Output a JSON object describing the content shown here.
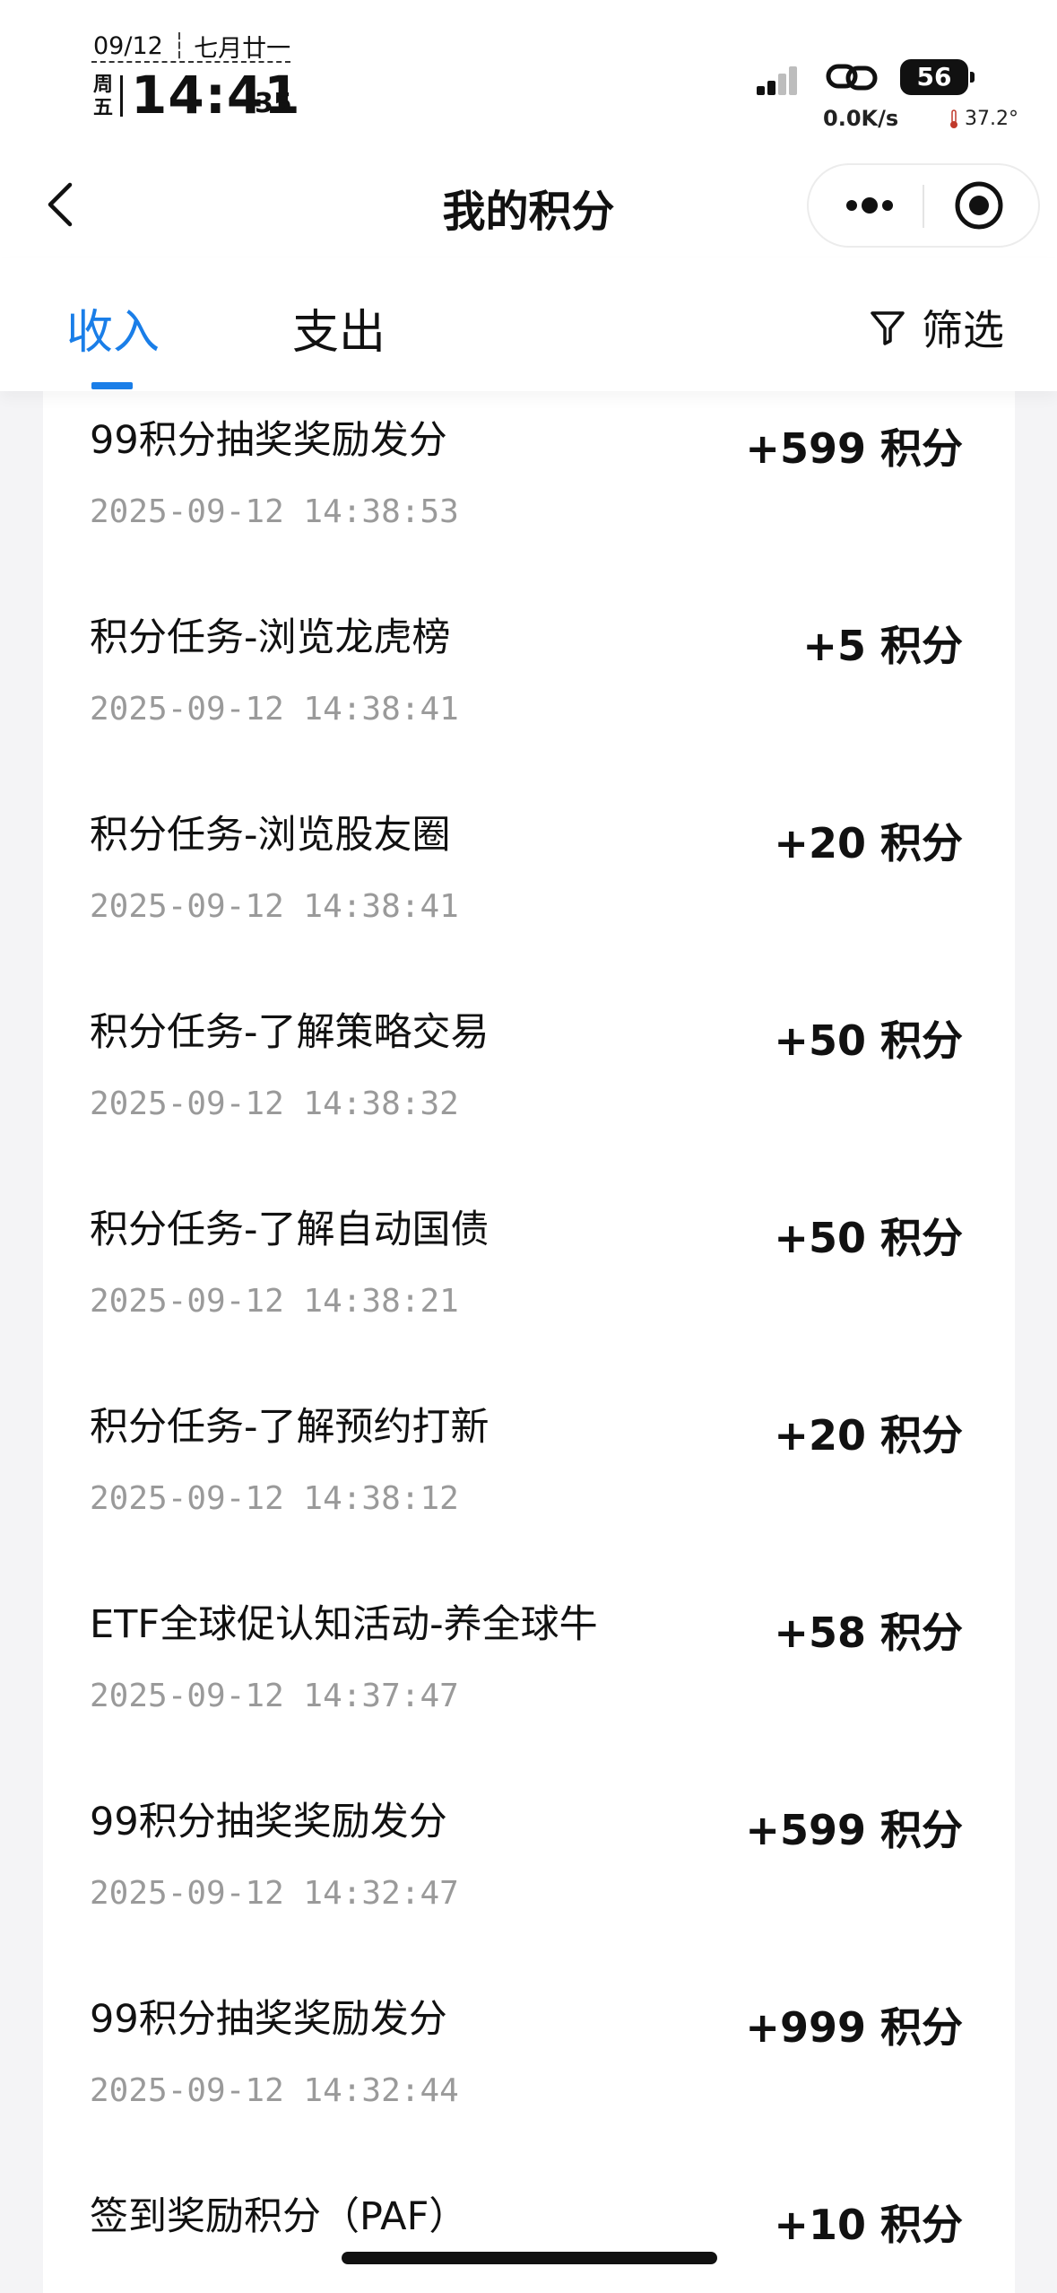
{
  "status_bar": {
    "date": "09/12",
    "lunar": "七月廿一",
    "weekday": "周五",
    "time": "14:41",
    "seconds": "35",
    "net_speed": "0.0K/s",
    "battery": "56",
    "temperature": "37.2°"
  },
  "nav": {
    "title": "我的积分"
  },
  "tabs": {
    "income": "收入",
    "expense": "支出",
    "filter": "筛选",
    "active": "income"
  },
  "colors": {
    "accent": "#1a7ee8",
    "background": "#f4f4f6",
    "time_text": "#9a9a9a"
  },
  "records": [
    {
      "title": "99积分抽奖奖励发分",
      "time": "2025-09-12 14:38:53",
      "points": "+599 积分"
    },
    {
      "title": "积分任务-浏览龙虎榜",
      "time": "2025-09-12 14:38:41",
      "points": "+5 积分"
    },
    {
      "title": "积分任务-浏览股友圈",
      "time": "2025-09-12 14:38:41",
      "points": "+20 积分"
    },
    {
      "title": "积分任务-了解策略交易",
      "time": "2025-09-12 14:38:32",
      "points": "+50 积分"
    },
    {
      "title": "积分任务-了解自动国债",
      "time": "2025-09-12 14:38:21",
      "points": "+50 积分"
    },
    {
      "title": "积分任务-了解预约打新",
      "time": "2025-09-12 14:38:12",
      "points": "+20 积分"
    },
    {
      "title": "ETF全球促认知活动-养全球牛",
      "time": "2025-09-12 14:37:47",
      "points": "+58 积分"
    },
    {
      "title": "99积分抽奖奖励发分",
      "time": "2025-09-12 14:32:47",
      "points": "+599 积分"
    },
    {
      "title": "99积分抽奖奖励发分",
      "time": "2025-09-12 14:32:44",
      "points": "+999 积分"
    },
    {
      "title": "签到奖励积分（PAF）",
      "time": "",
      "points": "+10 积分"
    }
  ]
}
